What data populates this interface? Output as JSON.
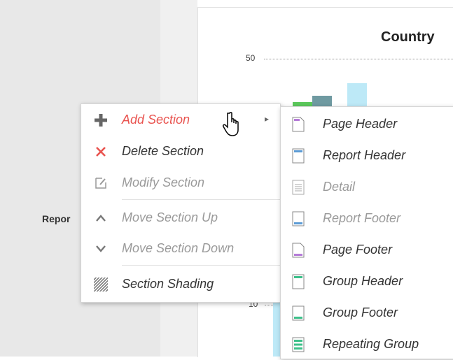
{
  "left": {
    "label": "Repor"
  },
  "chart": {
    "title": "Country",
    "tick_50": "50",
    "tick_10": "10"
  },
  "context_menu": {
    "items": [
      {
        "label": "Add Section",
        "icon": "plus-icon",
        "state": "active"
      },
      {
        "label": "Delete Section",
        "icon": "x-icon",
        "state": "enabled"
      },
      {
        "label": "Modify Section",
        "icon": "edit-icon",
        "state": "disabled"
      },
      {
        "label": "Move Section Up",
        "icon": "chevron-up-icon",
        "state": "disabled"
      },
      {
        "label": "Move Section Down",
        "icon": "chevron-down-icon",
        "state": "disabled"
      },
      {
        "label": "Section Shading",
        "icon": "shading-icon",
        "state": "enabled"
      }
    ]
  },
  "submenu": {
    "items": [
      {
        "label": "Page Header",
        "icon": "page-header-icon",
        "state": "enabled"
      },
      {
        "label": "Report Header",
        "icon": "report-header-icon",
        "state": "enabled"
      },
      {
        "label": "Detail",
        "icon": "detail-icon",
        "state": "disabled"
      },
      {
        "label": "Report Footer",
        "icon": "report-footer-icon",
        "state": "disabled"
      },
      {
        "label": "Page Footer",
        "icon": "page-footer-icon",
        "state": "enabled"
      },
      {
        "label": "Group Header",
        "icon": "group-header-icon",
        "state": "enabled"
      },
      {
        "label": "Group Footer",
        "icon": "group-footer-icon",
        "state": "enabled"
      },
      {
        "label": "Repeating Group",
        "icon": "repeating-group-icon",
        "state": "enabled"
      }
    ]
  },
  "colors": {
    "accent": "#e9534f",
    "purple": "#b57bd8",
    "blue": "#5b9bd5",
    "green": "#3cc08a"
  }
}
